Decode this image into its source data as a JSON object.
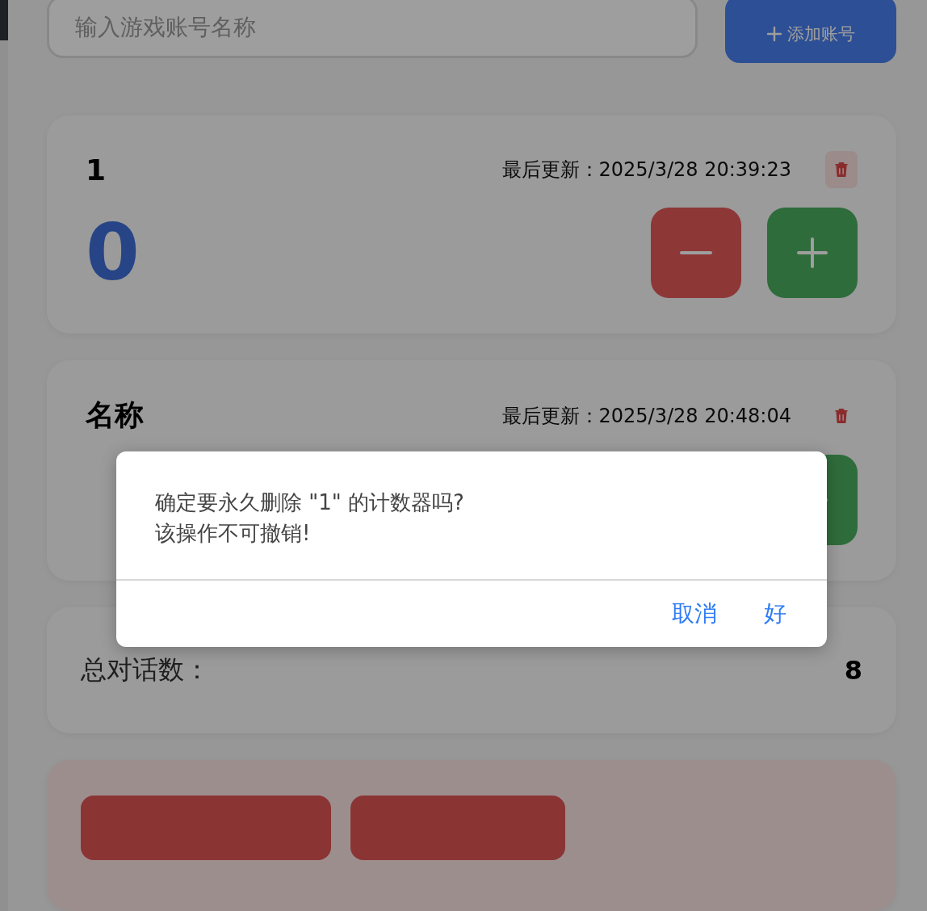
{
  "account_input": {
    "placeholder": "输入游戏账号名称"
  },
  "add_button": {
    "label": "添加账号"
  },
  "counters": [
    {
      "name": "1",
      "updated_label": "最后更新：",
      "updated": "2025/3/28 20:39:23",
      "count": "0",
      "delete_highlighted": true
    },
    {
      "name": "名称",
      "updated_label": "最后更新：",
      "updated": "2025/3/28 20:48:04",
      "delete_highlighted": false
    }
  ],
  "total": {
    "label": "总对话数：",
    "value": "8"
  },
  "dialog": {
    "lines": [
      "确定要永久删除 \"1\" 的计数器吗?",
      "该操作不可撤销!"
    ],
    "buttons": [
      {
        "label": "取消"
      },
      {
        "label": "好"
      }
    ]
  }
}
